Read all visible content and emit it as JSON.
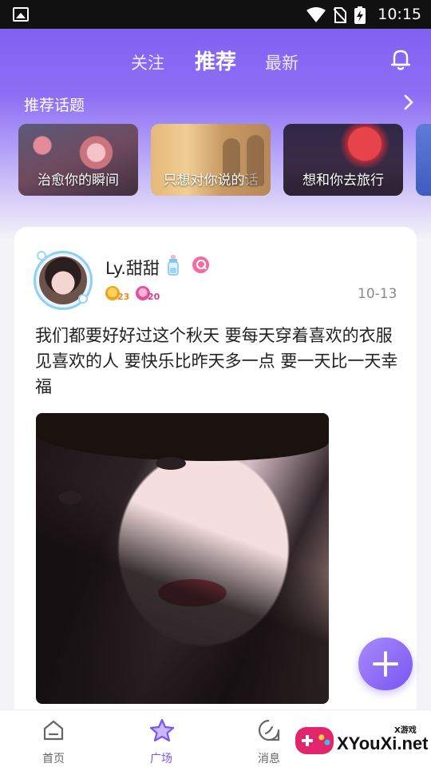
{
  "status_bar": {
    "time": "10:15"
  },
  "header": {
    "tabs": [
      {
        "label": "关注",
        "active": false
      },
      {
        "label": "推荐",
        "active": true
      },
      {
        "label": "最新",
        "active": false
      }
    ]
  },
  "topics": {
    "title": "推荐话题",
    "items": [
      {
        "label": "治愈你的瞬间"
      },
      {
        "label": "只想对你说的话"
      },
      {
        "label": "想和你去旅行"
      }
    ]
  },
  "post": {
    "username": "Ly.甜甜",
    "badges": [
      {
        "value": "23"
      },
      {
        "value": "20"
      }
    ],
    "date": "10-13",
    "text": " 我们都要好好过这个秋天 要每天穿着喜欢的衣服见喜欢的人 要快乐比昨天多一点 要一天比一天幸福"
  },
  "bottom_nav": {
    "items": [
      {
        "label": "首页",
        "active": false
      },
      {
        "label": "广场",
        "active": true
      },
      {
        "label": "消息",
        "active": false
      }
    ]
  },
  "watermark": {
    "tag": "X游戏",
    "brand": "XYouXi.net"
  },
  "colors": {
    "accent": "#7a55f3",
    "header_gradient_top": "#7b5cf2"
  }
}
